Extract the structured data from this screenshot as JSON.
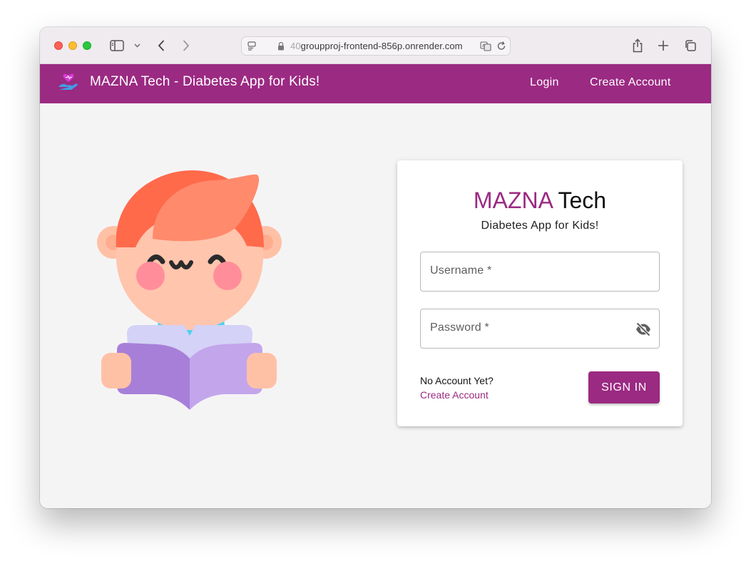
{
  "browser": {
    "url_prefix": "40",
    "url_main": "groupproj-frontend-856p.onrender.com"
  },
  "navbar": {
    "brand": "MAZNA Tech - Diabetes App for Kids!",
    "login_label": "Login",
    "create_account_label": "Create Account",
    "color": "#9b2a82"
  },
  "login_card": {
    "title_accent": "MAZNA",
    "title_rest": " Tech",
    "subtitle": "Diabetes App for Kids!",
    "username_label": "Username *",
    "password_label": "Password *",
    "no_account_text": "No Account Yet?",
    "create_account_link": "Create Account",
    "sign_in_label": "SIGN IN"
  },
  "icons": {
    "logo": "heart-hand-icon",
    "password_toggle": "eye-off-icon",
    "illustration": "kid-reading-book"
  }
}
